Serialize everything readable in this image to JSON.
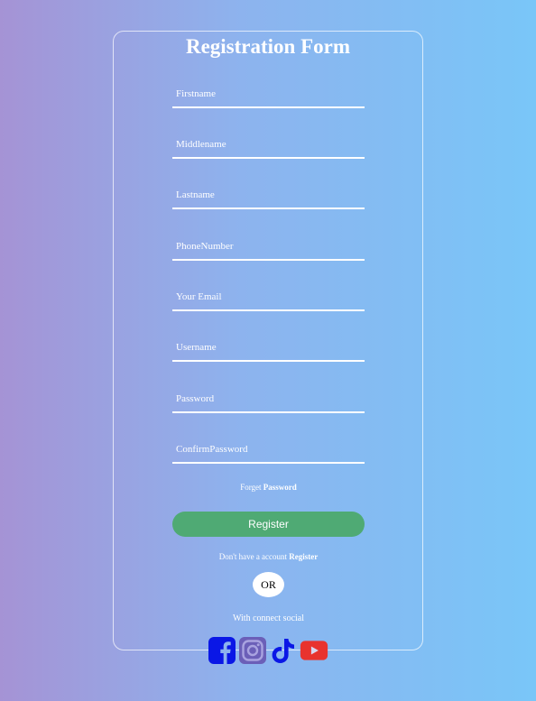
{
  "form": {
    "title": "Registration Form",
    "fields": [
      {
        "placeholder": "Firstname"
      },
      {
        "placeholder": "Middlename"
      },
      {
        "placeholder": "Lastname"
      },
      {
        "placeholder": "PhoneNumber"
      },
      {
        "placeholder": "Your Email"
      },
      {
        "placeholder": "Username"
      },
      {
        "placeholder": "Password"
      },
      {
        "placeholder": "ConfirmPassword"
      }
    ],
    "forget_text": "Forget",
    "forget_link": "Password",
    "register_button": "Register",
    "account_text": "Don't have a account",
    "account_link": "Register",
    "or_label": "OR",
    "social_caption": "With connect social",
    "social_icons": [
      "facebook-icon",
      "instagram-icon",
      "tiktok-icon",
      "youtube-icon"
    ]
  },
  "colors": {
    "button": "#4faa74",
    "facebook": "#0a17e6",
    "instagram_bg": "#6b5fb8",
    "tiktok": "#0a17e6",
    "youtube": "#e8332e"
  }
}
